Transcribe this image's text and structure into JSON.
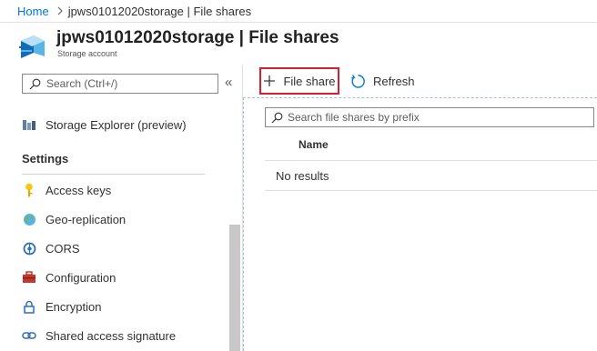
{
  "breadcrumb": {
    "home": "Home",
    "current": "jpws01012020storage | File shares"
  },
  "header": {
    "title": "jpws01012020storage | File shares",
    "subtitle": "Storage account"
  },
  "sidebar": {
    "search_placeholder": "Search (Ctrl+/)",
    "collapse": "«",
    "items": [
      {
        "label": "Storage Explorer (preview)",
        "icon": "storage-explorer-icon"
      }
    ],
    "section_title": "Settings",
    "settings_items": [
      {
        "label": "Access keys",
        "icon": "key-icon"
      },
      {
        "label": "Geo-replication",
        "icon": "globe-icon"
      },
      {
        "label": "CORS",
        "icon": "cors-icon"
      },
      {
        "label": "Configuration",
        "icon": "toolbox-icon"
      },
      {
        "label": "Encryption",
        "icon": "lock-icon"
      },
      {
        "label": "Shared access signature",
        "icon": "link-icon"
      }
    ]
  },
  "toolbar": {
    "add_label": "File share",
    "refresh_label": "Refresh"
  },
  "main": {
    "filter_placeholder": "Search file shares by prefix",
    "columns": [
      "Name"
    ],
    "empty_text": "No results"
  },
  "colors": {
    "accent": "#0078d4",
    "highlight_border": "#d6202e"
  }
}
